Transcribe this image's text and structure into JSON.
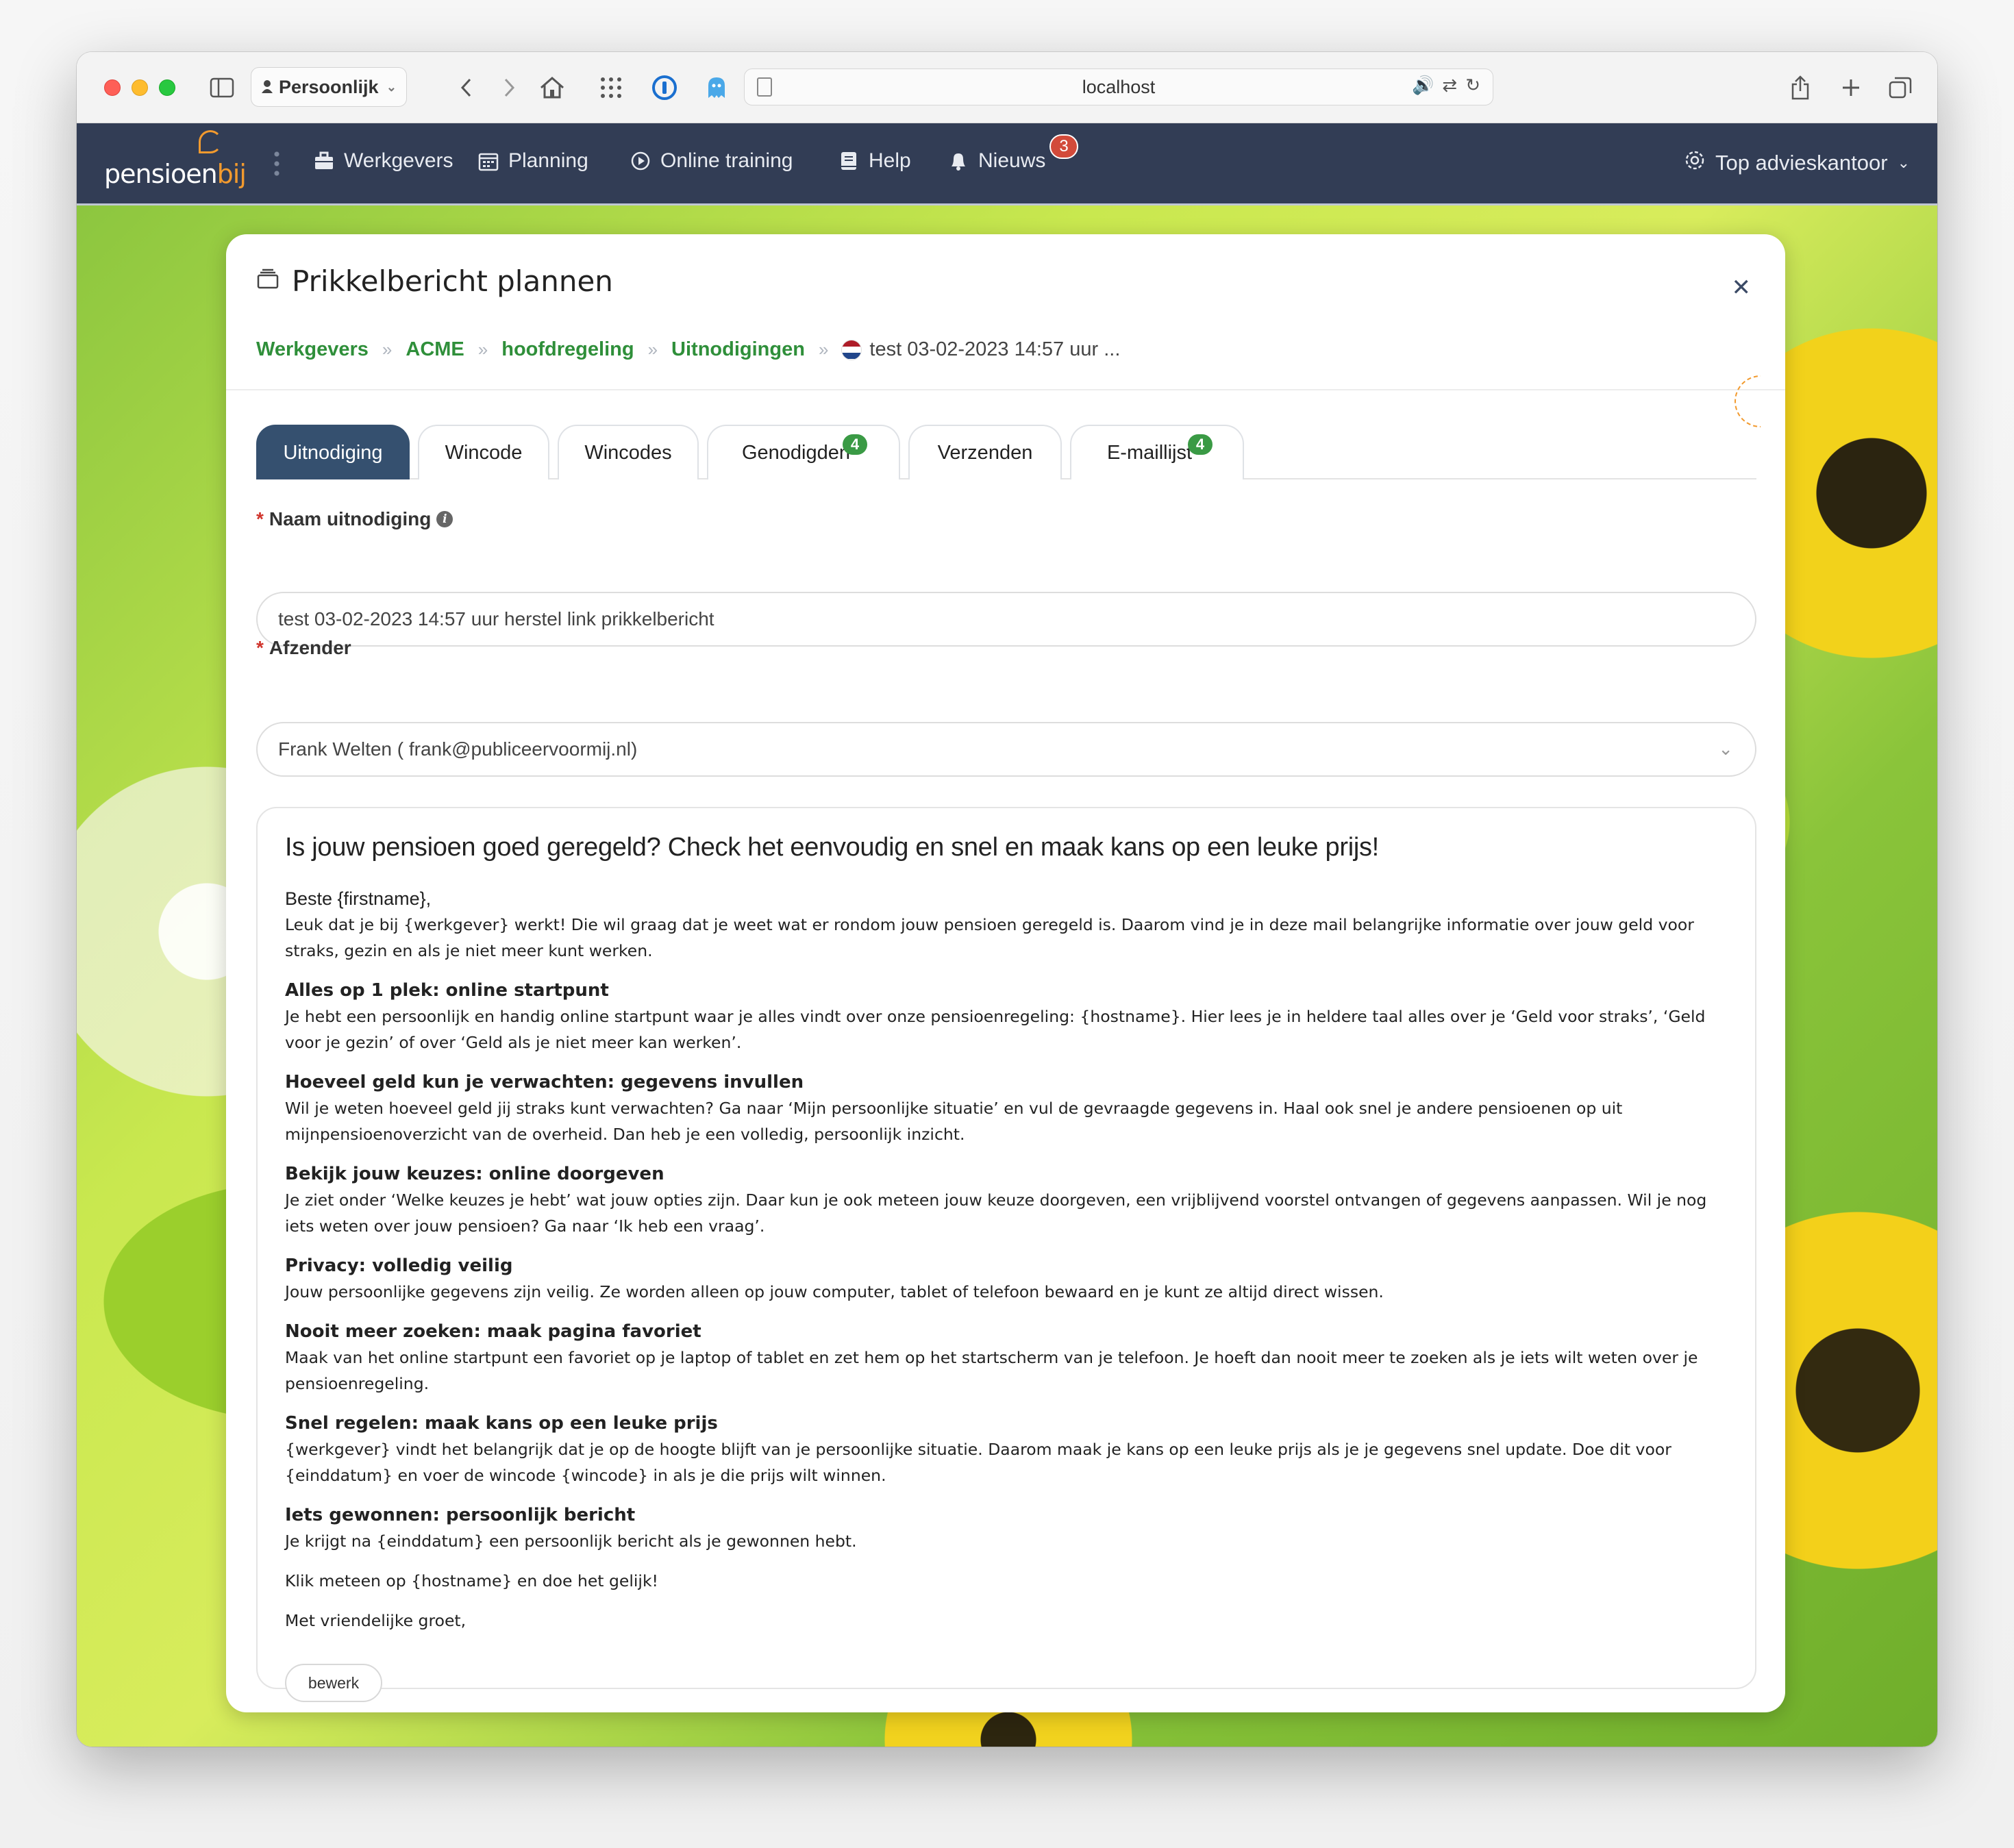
{
  "browser": {
    "profile_label": "Persoonlijk",
    "url": "localhost"
  },
  "navbar": {
    "items": [
      {
        "label": "Werkgevers",
        "icon": "briefcase-icon"
      },
      {
        "label": "Planning",
        "icon": "calendar-icon"
      },
      {
        "label": "Online training",
        "icon": "play-circle-icon"
      },
      {
        "label": "Help",
        "icon": "book-icon"
      },
      {
        "label": "Nieuws",
        "icon": "bell-icon"
      }
    ],
    "news_count": "3",
    "company": "Top advieskantoor"
  },
  "modal": {
    "title": "Prikkelbericht plannen",
    "breadcrumbs": [
      "Werkgevers",
      "ACME",
      "hoofdregeling",
      "Uitnodigingen"
    ],
    "breadcrumb_current": "test 03-02-2023 14:57 uur ...",
    "tabs": [
      {
        "label": "Uitnodiging",
        "active": true
      },
      {
        "label": "Wincode"
      },
      {
        "label": "Wincodes"
      },
      {
        "label": "Genodigden",
        "badge": "4"
      },
      {
        "label": "Verzenden"
      },
      {
        "label": "E-maillijst",
        "badge": "4"
      }
    ]
  },
  "form": {
    "name_label": "Naam uitnodiging",
    "name_value": "test 03-02-2023 14:57 uur herstel link prikkelbericht",
    "sender_label": "Afzender",
    "sender_value": "Frank Welten ( frank@publiceervoormij.nl)"
  },
  "email": {
    "subject": "Is jouw pensioen goed geregeld? Check het eenvoudig en snel en maak kans op een leuke prijs!",
    "greeting": "Beste {firstname},",
    "intro": "Leuk dat je bij {werkgever} werkt! Die wil graag dat je weet wat er rondom jouw pensioen geregeld is. Daarom vind je in deze mail belangrijke informatie over jouw geld voor straks, gezin en als je niet meer kunt werken.",
    "sections": [
      {
        "heading": "Alles op 1 plek: online startpunt",
        "text": "Je hebt een persoonlijk en handig online startpunt waar je alles vindt over onze pensioenregeling: {hostname}. Hier lees je in heldere taal alles over je ‘Geld voor straks’, ‘Geld voor je gezin’ of over ‘Geld als je niet meer kan werken’."
      },
      {
        "heading": "Hoeveel geld kun je verwachten: gegevens invullen",
        "text": "Wil je weten hoeveel geld jij straks kunt verwachten? Ga naar ‘Mijn persoonlijke situatie’ en vul de gevraagde gegevens in. Haal ook snel je andere pensioenen op uit mijnpensioenoverzicht van de overheid. Dan heb je een volledig, persoonlijk inzicht."
      },
      {
        "heading": "Bekijk jouw keuzes: online doorgeven",
        "text": "Je ziet onder ‘Welke keuzes je hebt’ wat jouw opties zijn. Daar kun je ook meteen jouw keuze doorgeven, een vrijblijvend voorstel ontvangen of gegevens aanpassen. Wil je nog iets weten over jouw pensioen? Ga naar ‘Ik heb een vraag’."
      },
      {
        "heading": "Privacy: volledig veilig",
        "text": "Jouw persoonlijke gegevens zijn veilig. Ze worden alleen op jouw computer, tablet of telefoon bewaard en je kunt ze altijd direct wissen."
      },
      {
        "heading": "Nooit meer zoeken: maak pagina favoriet",
        "text": "Maak van het online startpunt een favoriet op je laptop of tablet en zet hem op het startscherm van je telefoon. Je hoeft dan nooit meer te zoeken als je iets wilt weten over je pensioenregeling."
      },
      {
        "heading": "Snel regelen: maak kans op een leuke prijs",
        "text": "{werkgever} vindt het belangrijk dat je op de hoogte blijft van je persoonlijke situatie. Daarom maak je kans op een leuke prijs als je je gegevens snel update. Doe dit voor {einddatum} en voer de wincode {wincode} in als je die prijs wilt winnen."
      },
      {
        "heading": "Iets gewonnen: persoonlijk bericht",
        "text": "Je krijgt na {einddatum} een persoonlijk bericht als je gewonnen hebt."
      }
    ],
    "cta": "Klik meteen op {hostname} en doe het gelijk!",
    "closing": "Met vriendelijke groet,",
    "edit_label": "bewerk"
  },
  "colors": {
    "navbar": "#323d55",
    "tab_active": "#35506f",
    "link_green": "#2f8f3a",
    "badge_green": "#3a9a45",
    "badge_red": "#d24a3a",
    "accent_orange": "#f29a2e"
  }
}
